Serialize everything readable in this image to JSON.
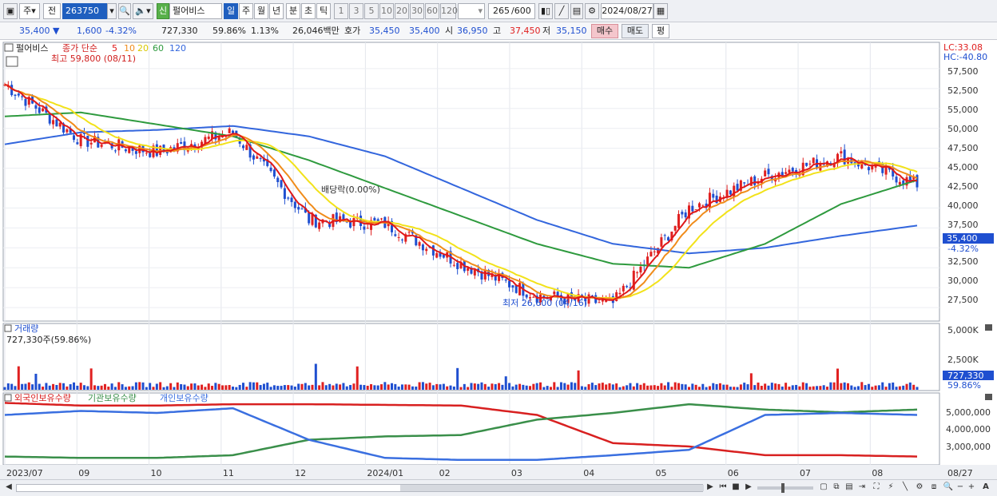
{
  "toolbar": {
    "period_prefix": "주",
    "prev_label": "전",
    "stock_code": "263750",
    "market_badge": "신",
    "stock_name": "펄어비스",
    "periods": [
      "일",
      "주",
      "월",
      "년",
      "분",
      "초",
      "틱"
    ],
    "active_period": "일",
    "intervals": [
      "1",
      "3",
      "5",
      "10",
      "20",
      "30",
      "60",
      "120"
    ],
    "count_value": "265",
    "count_max": "/600",
    "date_value": "2024/08/27"
  },
  "quote": {
    "price": "35,400",
    "direction": "▼",
    "change": "1,600",
    "change_pct": "-4.32%",
    "volume": "727,330",
    "volume_ratio": "59.86%",
    "turnover": "1.13%",
    "amount": "26,046백만",
    "ask_label": "호가",
    "ask1": "35,450",
    "bid1": "35,400",
    "open_label": "시",
    "open": "36,950",
    "high_label": "고",
    "high": "37,450",
    "low_label": "저",
    "low": "35,150",
    "buy_label": "매수",
    "sell_label": "매도",
    "eval_label": "평"
  },
  "price_panel": {
    "name": "펄어비스",
    "legend_prefix": "종가 단순",
    "ma_periods": [
      "5",
      "10",
      "20",
      "60",
      "120"
    ],
    "high_marker": "최고 59,800 (08/11)",
    "low_marker": "최저 26,600 (04/16)",
    "dividend_marker": "배당락(0.00%)",
    "lc_label": "LC:33.08",
    "hc_label": "HC:-40.80",
    "current_price_tag": "35,400",
    "current_pct_tag": "-4.32%",
    "y_ticks": [
      "57,500",
      "55,000",
      "52,500",
      "50,000",
      "47,500",
      "45,000",
      "42,500",
      "40,000",
      "37,500",
      "32,500",
      "30,000",
      "27,500"
    ]
  },
  "volume_panel": {
    "title": "거래량",
    "value_label": "727,330주(59.86%)",
    "y_ticks": [
      "5,000K",
      "2,500K"
    ],
    "current_tag": "727,330",
    "current_pct": "59.86%"
  },
  "holding_panel": {
    "legend": [
      "외국인보유수량",
      "기관보유수량",
      "개인보유수량"
    ],
    "y_ticks": [
      "5,000,000",
      "4,000,000",
      "3,000,000"
    ]
  },
  "x_axis": {
    "labels": [
      "2023/07",
      "09",
      "10",
      "11",
      "12",
      "2024/01",
      "02",
      "03",
      "04",
      "05",
      "06",
      "07",
      "08"
    ],
    "last_date": "08/27"
  },
  "colors": {
    "candle_up": "#e02020",
    "candle_down": "#1f4fd0",
    "ma5": "#e01818",
    "ma10": "#f08c1a",
    "ma20": "#f2e21a",
    "ma60": "#2e9a3e",
    "ma120": "#3366dd",
    "foreign": "#d82020",
    "institution": "#3a8f4a",
    "individual": "#3a6fe0"
  },
  "chart_data": {
    "type": "line",
    "title": "",
    "x": [
      "2023/07",
      "09",
      "10",
      "11",
      "12",
      "2024/01",
      "02",
      "03",
      "04",
      "05",
      "06",
      "07",
      "08"
    ],
    "series": [
      {
        "name": "종가",
        "values": [
          55500,
          48500,
          47000,
          49500,
          38500,
          38000,
          33000,
          29000,
          28000,
          40000,
          44000,
          46500,
          43000
        ]
      },
      {
        "name": "120",
        "values": [
          48000,
          49500,
          49800,
          50300,
          49000,
          46500,
          42500,
          38500,
          35500,
          34300,
          35000,
          36500,
          37800
        ]
      },
      {
        "name": "60",
        "values": [
          51500,
          52000,
          50500,
          49000,
          46000,
          42500,
          39000,
          35500,
          33000,
          32500,
          35500,
          40500,
          43500
        ]
      }
    ],
    "ylim": [
      25000,
      60000
    ],
    "x_axis": "date",
    "y_axis_right": true
  }
}
